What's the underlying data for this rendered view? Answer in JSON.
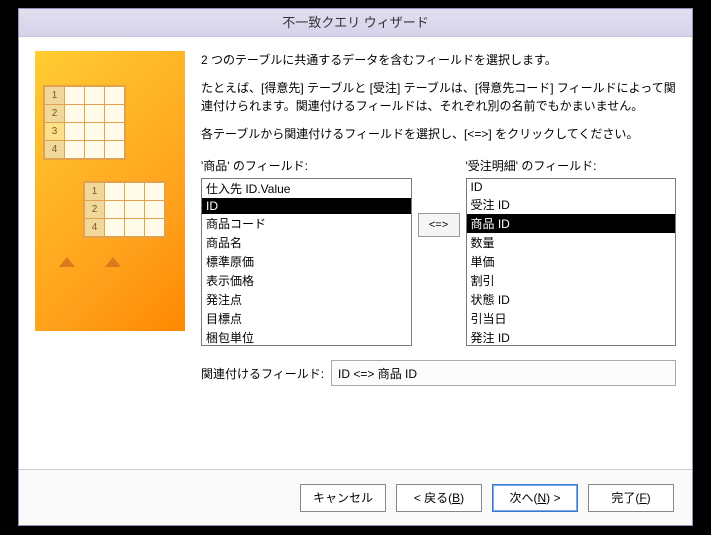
{
  "title": "不一致クエリ ウィザード",
  "instructions": {
    "line1": "2 つのテーブルに共通するデータを含むフィールドを選択します。",
    "line2": "たとえば、[得意先] テーブルと [受注] テーブルは、[得意先コード] フィールドによって関連付けられます。関連付けるフィールドは、それぞれ別の名前でもかまいません。",
    "line3": "各テーブルから関連付けるフィールドを選択し、[<=>] をクリックしてください。"
  },
  "leftList": {
    "label": "'商品' のフィールド:",
    "items": [
      "仕入先 ID.Value",
      "ID",
      "商品コード",
      "商品名",
      "標準原価",
      "表示価格",
      "発注点",
      "目標点",
      "梱包単位"
    ],
    "selected": "ID"
  },
  "rightList": {
    "label": "'受注明細' のフィールド:",
    "items": [
      "ID",
      "受注 ID",
      "商品 ID",
      "数量",
      "単価",
      "割引",
      "状態 ID",
      "引当日",
      "発注 ID"
    ],
    "selected": "商品 ID"
  },
  "arrowButton": "<=>",
  "matching": {
    "label": "関連付けるフィールド:",
    "value": "ID <=> 商品 ID"
  },
  "buttons": {
    "cancel": "キャンセル",
    "back": "< 戻る(B)",
    "next": "次へ(N) >",
    "finish": "完了(F)"
  }
}
